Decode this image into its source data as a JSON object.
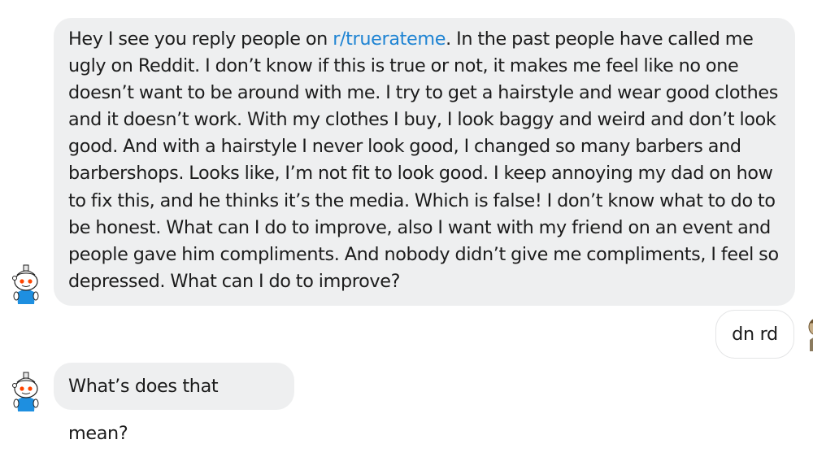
{
  "messages": [
    {
      "sender": "other",
      "avatar": "snoo-avatar-icon",
      "text_before_link": "Hey I see you reply people on ",
      "link": "r/truerateme",
      "text_after_link": ". In the past people have called me ugly on Reddit. I don’t know if this is true or not, it makes me feel like no one doesn’t want to be around with me. I try to get a hairstyle and wear good clothes and it doesn’t work. With my clothes I buy, I look baggy and weird and don’t look good. And with a hairstyle I never look good, I changed so many barbers and barbershops. Looks like, I’m not fit to look good. I keep annoying my dad on how to fix this, and he thinks it’s the media. Which is false! I don’t know what to do to be honest. What can I do to improve, also I want with my friend on an event and people gave him compliments. And nobody didn’t give me compliments, I feel so depressed. What can I do to improve?"
    },
    {
      "sender": "self",
      "avatar": "user-avatar-icon",
      "text": "dn rd"
    },
    {
      "sender": "other",
      "avatar": "snoo-avatar-icon",
      "text": "What’s does that mean?"
    }
  ],
  "colors": {
    "incoming_bubble": "#eeeff0",
    "link": "#1f84d3",
    "text": "#1c1c1c"
  }
}
